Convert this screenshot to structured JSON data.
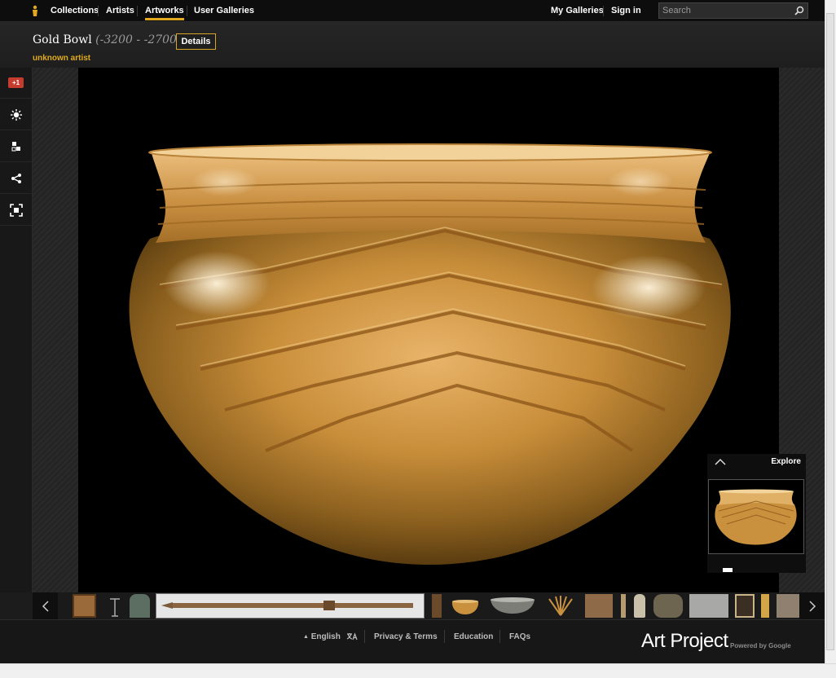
{
  "nav": {
    "items": [
      {
        "label": "Collections"
      },
      {
        "label": "Artists"
      },
      {
        "label": "Artworks"
      },
      {
        "label": "User Galleries"
      }
    ],
    "active": "Artworks",
    "my_galleries": "My Galleries",
    "sign_in": "Sign in",
    "search_placeholder": "Search",
    "accent_color": "#e2a91f"
  },
  "artwork": {
    "title": "Gold Bowl",
    "dates": "(-3200 - -2700)",
    "artist": "unknown artist",
    "details_label": "Details"
  },
  "toolbar": {
    "icons": [
      "google-plus-one-icon",
      "lightbulb-icon",
      "compare-icon",
      "share-icon",
      "zoom-fit-icon"
    ],
    "plus_one_label": "+1"
  },
  "explore": {
    "label": "Explore"
  },
  "filmstrip": {
    "items": [
      "framed-relief",
      "candelabra",
      "stone-stele",
      "iron-sword",
      "figurine",
      "gold-bowl",
      "silver-bowl",
      "gold-wreath",
      "carved-panel",
      "small-figure",
      "statuette",
      "stone-vessel",
      "temple-ruin",
      "painted-icon",
      "gold-idol",
      "tablet"
    ],
    "selected": "gold-bowl"
  },
  "footer": {
    "language": "English",
    "links": [
      "Privacy & Terms",
      "Education",
      "FAQs"
    ],
    "brand": "Art Project",
    "powered_by": "Powered by Google"
  }
}
